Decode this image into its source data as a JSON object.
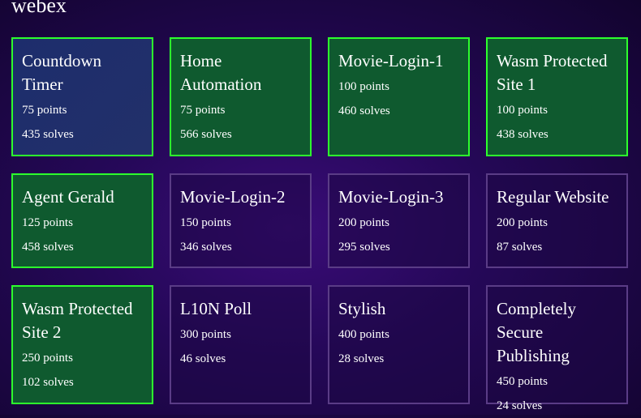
{
  "section": {
    "title": "webex"
  },
  "challenges": [
    {
      "name": "Countdown Timer",
      "points": "75 points",
      "solves": "435 solves",
      "state": "active"
    },
    {
      "name": "Home Automation",
      "points": "75 points",
      "solves": "566 solves",
      "state": "solved"
    },
    {
      "name": "Movie-Login-1",
      "points": "100 points",
      "solves": "460 solves",
      "state": "solved"
    },
    {
      "name": "Wasm Protected Site 1",
      "points": "100 points",
      "solves": "438 solves",
      "state": "solved"
    },
    {
      "name": "Agent Gerald",
      "points": "125 points",
      "solves": "458 solves",
      "state": "solved"
    },
    {
      "name": "Movie-Login-2",
      "points": "150 points",
      "solves": "346 solves",
      "state": "unsolved"
    },
    {
      "name": "Movie-Login-3",
      "points": "200 points",
      "solves": "295 solves",
      "state": "unsolved"
    },
    {
      "name": "Regular Website",
      "points": "200 points",
      "solves": "87 solves",
      "state": "unsolved"
    },
    {
      "name": "Wasm Protected Site 2",
      "points": "250 points",
      "solves": "102 solves",
      "state": "solved"
    },
    {
      "name": "L10N Poll",
      "points": "300 points",
      "solves": "46 solves",
      "state": "unsolved"
    },
    {
      "name": "Stylish",
      "points": "400 points",
      "solves": "28 solves",
      "state": "unsolved"
    },
    {
      "name": "Completely Secure Publishing",
      "points": "450 points",
      "solves": "24 solves",
      "state": "unsolved"
    }
  ],
  "colors": {
    "solved_border": "#2dff2d",
    "solved_bg": "#0f5a2f",
    "active_bg": "#1d2d6c",
    "unsolved_border": "#5a3c86"
  }
}
